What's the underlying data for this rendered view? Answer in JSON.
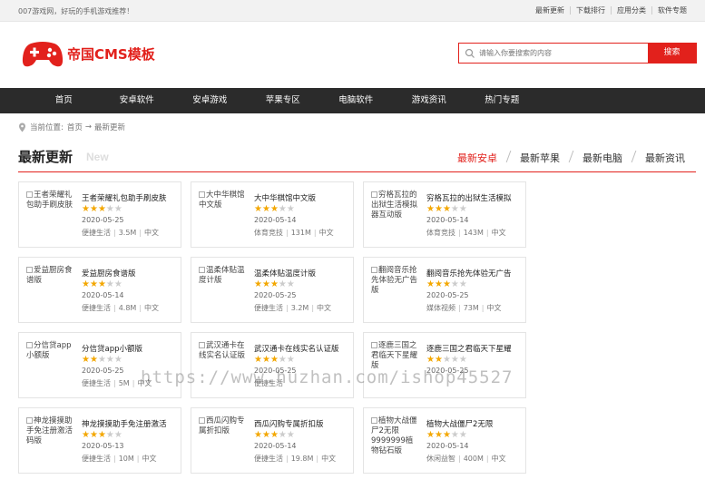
{
  "topbar": {
    "welcome": "007游戏网，好玩的手机游戏推荐！",
    "links": [
      "最新更新",
      "下载排行",
      "应用分类",
      "软件专题"
    ]
  },
  "logo": {
    "title": "帝国CMS模板",
    "color": "#e2211c"
  },
  "search": {
    "placeholder": "请输入你要搜索的内容",
    "button": "搜索"
  },
  "nav": [
    "首页",
    "安卓软件",
    "安卓游戏",
    "苹果专区",
    "电脑软件",
    "游戏资讯",
    "热门专题"
  ],
  "breadcrumb": {
    "label": "当前位置:",
    "home": "首页",
    "arrow": "→",
    "current": "最新更新"
  },
  "section": {
    "title": "最新更新",
    "subtitle": "New",
    "tabs": [
      "最新安卓",
      "最新苹果",
      "最新电脑",
      "最新资讯"
    ],
    "active_tab": 0
  },
  "items": [
    {
      "alt": "王者荣耀礼包助手刷皮肤",
      "name": "王者荣耀礼包助手刷皮肤",
      "rating": 3,
      "date": "2020-05-25",
      "category": "便捷生活",
      "size": "3.5M",
      "lang": "中文"
    },
    {
      "alt": "大中华棋馆中文版",
      "name": "大中华棋馆中文版",
      "rating": 3,
      "date": "2020-05-14",
      "category": "体育竞技",
      "size": "131M",
      "lang": "中文"
    },
    {
      "alt": "穷格瓦拉的出狱生活模拟器互动版",
      "name": "穷格瓦拉的出狱生活模拟",
      "rating": 3,
      "date": "2020-05-14",
      "category": "体育竞技",
      "size": "143M",
      "lang": "中文"
    },
    {
      "alt": "爱益厨房食谱版",
      "name": "爱益厨房食谱版",
      "rating": 3,
      "date": "2020-05-14",
      "category": "便捷生活",
      "size": "4.8M",
      "lang": "中文"
    },
    {
      "alt": "温柔体贴温度计版",
      "name": "温柔体贴温度计版",
      "rating": 3,
      "date": "2020-05-25",
      "category": "便捷生活",
      "size": "3.2M",
      "lang": "中文"
    },
    {
      "alt": "翻阅音乐抢先体验无广告版",
      "name": "翻阅音乐抢先体验无广告",
      "rating": 3,
      "date": "2020-05-25",
      "category": "媒体视频",
      "size": "73M",
      "lang": "中文"
    },
    {
      "alt": "分信贷app小额版",
      "name": "分信贷app小额版",
      "rating": 2,
      "date": "2020-05-25",
      "category": "便捷生活",
      "size": "5M",
      "lang": "中文"
    },
    {
      "alt": "武汉通卡在线实名认证版",
      "name": "武汉通卡在线实名认证版",
      "rating": 3,
      "date": "2020-05-25",
      "category": "便捷生活",
      "size": "",
      "lang": ""
    },
    {
      "alt": "逐鹿三国之君临天下星耀版",
      "name": "逐鹿三国之君临天下星耀",
      "rating": 2,
      "date": "2020-05-25",
      "category": "",
      "size": "",
      "lang": ""
    },
    {
      "alt": "神龙摸摸助手免注册激活码版",
      "name": "神龙摸摸助手免注册激活",
      "rating": 3,
      "date": "2020-05-13",
      "category": "便捷生活",
      "size": "10M",
      "lang": "中文"
    },
    {
      "alt": "西瓜闪购专属折扣版",
      "name": "西瓜闪购专属折扣版",
      "rating": 3,
      "date": "2020-05-14",
      "category": "便捷生活",
      "size": "19.8M",
      "lang": "中文"
    },
    {
      "alt": "植物大战僵尸2无限9999999植物钻石版",
      "name": "植物大战僵尸2无限",
      "rating": 3,
      "date": "2020-05-14",
      "category": "休闲益智",
      "size": "400M",
      "lang": "中文"
    }
  ],
  "watermark": "https://www.huzhan.com/ishop45527"
}
